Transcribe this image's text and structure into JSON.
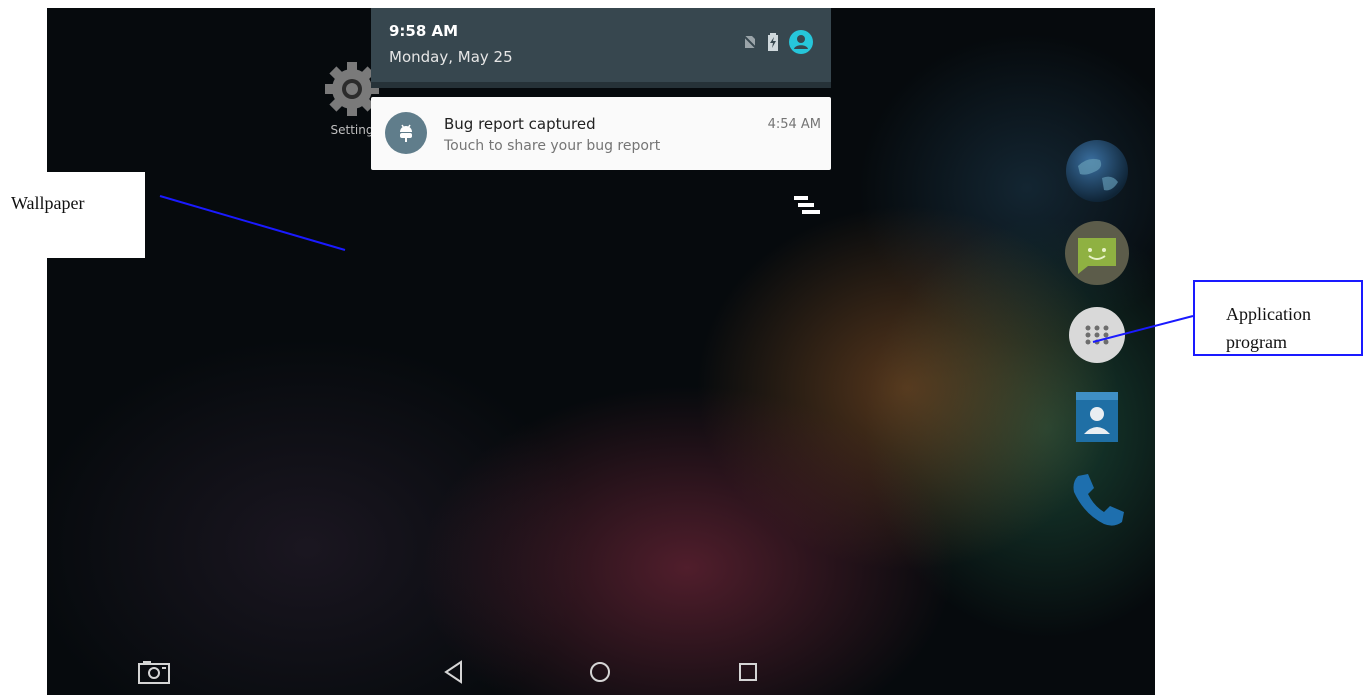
{
  "status_shade": {
    "time": "9:58 AM",
    "date": "Monday, May 25",
    "icons": [
      "no-sim-icon",
      "battery-charging-icon",
      "user-avatar-icon"
    ]
  },
  "home_apps": {
    "settings_label": "Setting"
  },
  "notification": {
    "icon": "android-bug-icon",
    "title": "Bug report captured",
    "text": "Touch to share your bug report",
    "time": "4:54 AM"
  },
  "dock_apps": [
    "browser-globe-icon",
    "messaging-icon",
    "app-drawer-icon",
    "contacts-icon",
    "phone-icon"
  ],
  "navbar": {
    "buttons": [
      "screenshot-icon",
      "back-icon",
      "home-icon",
      "recents-icon"
    ]
  },
  "annotations": {
    "wallpaper": "Wallpaper",
    "app_line1": "Application",
    "app_line2": "program",
    "line_color": "#1a1aff"
  }
}
